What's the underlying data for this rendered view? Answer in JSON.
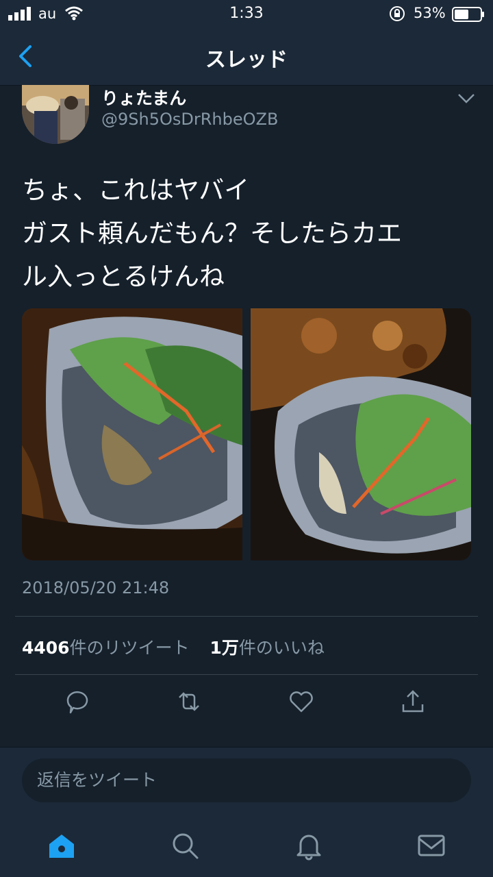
{
  "status": {
    "carrier": "au",
    "time": "1:33",
    "battery": "53%"
  },
  "nav": {
    "title": "スレッド"
  },
  "tweet": {
    "name": "りょたまん",
    "handle": "@9Sh5OsDrRhbeOZB",
    "lines": [
      "ちょ、これはヤバイ",
      "ガスト頼んだもん？そしたらカエ",
      "ル入っとるけんね"
    ],
    "timestamp": "2018/05/20 21:48",
    "retweet_count": "4406",
    "retweet_label": "件のリツイート",
    "like_count": "1万",
    "like_label": "件のいいね"
  },
  "reply": {
    "placeholder": "返信をツイート"
  },
  "colors": {
    "background": "#15202b",
    "bar": "#1c2938",
    "accent": "#1da1f2",
    "muted": "#8899a6"
  }
}
